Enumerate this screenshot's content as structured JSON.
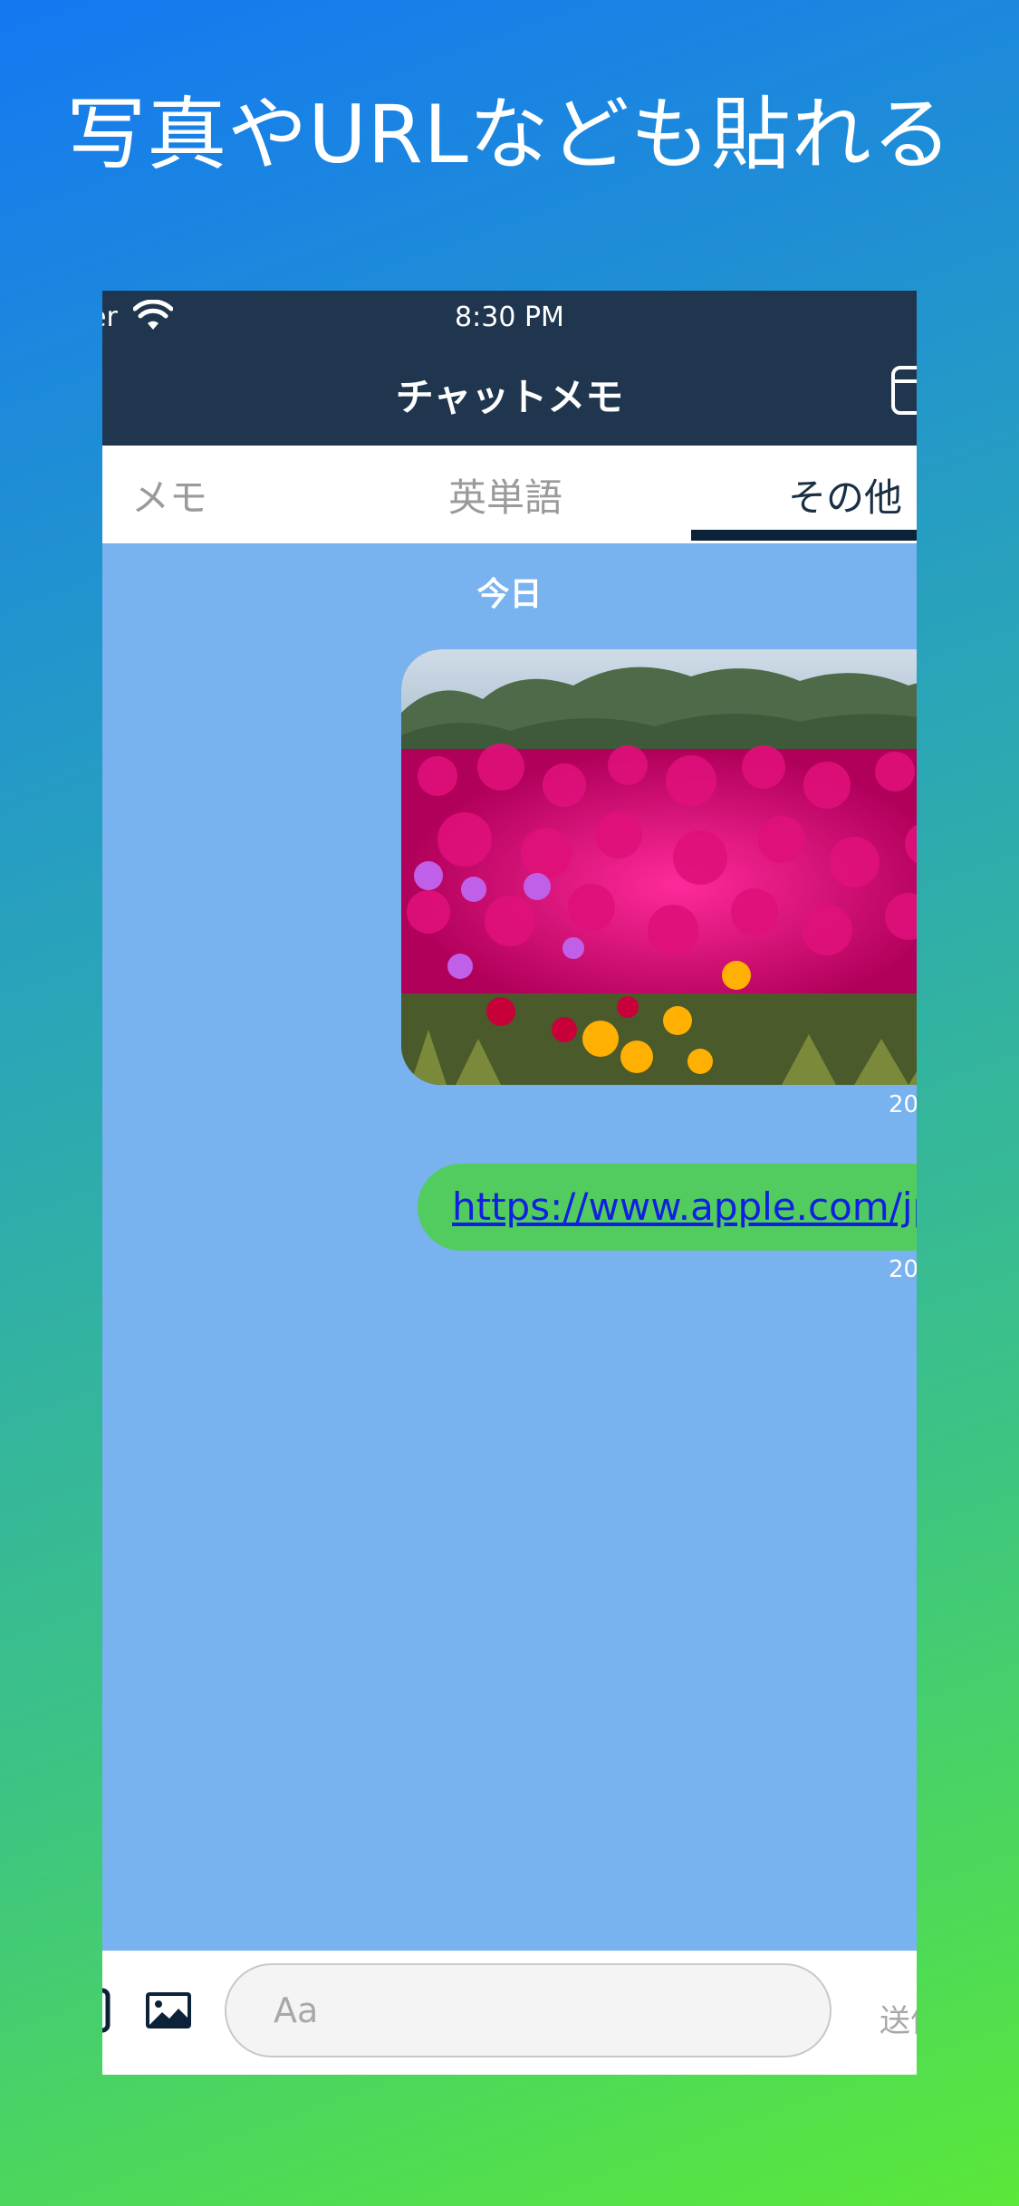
{
  "headline": "写真やURLなども貼れる",
  "status_bar": {
    "carrier": "er",
    "time": "8:30 PM"
  },
  "nav": {
    "title": "チャットメモ"
  },
  "tabs": [
    {
      "label": "メモ",
      "active": false
    },
    {
      "label": "英単語",
      "active": false
    },
    {
      "label": "その他",
      "active": true
    }
  ],
  "chat": {
    "date_separator": "今日",
    "messages": [
      {
        "type": "image",
        "description_icon": "flower-photo",
        "time": "20"
      },
      {
        "type": "link",
        "text": "https://www.apple.com/jp",
        "time": "20"
      }
    ]
  },
  "composer": {
    "placeholder": "Aa",
    "send_label": "送信"
  },
  "colors": {
    "nav_bg": "#20364f",
    "chat_bg": "#78b2ef",
    "bubble_green": "#52cc5e",
    "link_blue": "#1020e0",
    "tab_indicator": "#0c2238"
  }
}
